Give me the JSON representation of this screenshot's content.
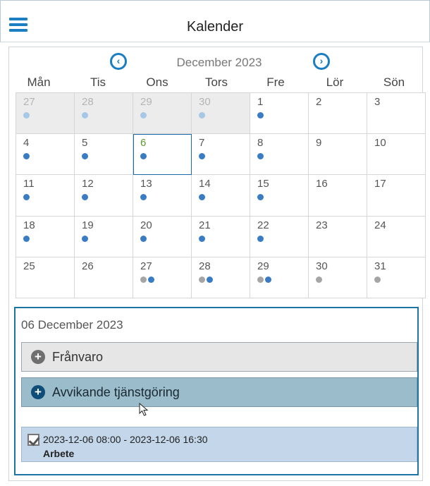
{
  "header": {
    "title": "Kalender"
  },
  "calendar": {
    "month_label": "December 2023",
    "weekdays": [
      "Mån",
      "Tis",
      "Ons",
      "Tors",
      "Fre",
      "Lör",
      "Sön"
    ],
    "cells": [
      {
        "day": "27",
        "other": true,
        "dots": [
          "faint"
        ]
      },
      {
        "day": "28",
        "other": true,
        "dots": [
          "faint"
        ]
      },
      {
        "day": "29",
        "other": true,
        "dots": [
          "faint"
        ]
      },
      {
        "day": "30",
        "other": true,
        "dots": [
          "faint"
        ]
      },
      {
        "day": "1",
        "other": false,
        "dots": [
          "blue"
        ]
      },
      {
        "day": "2",
        "other": false,
        "dots": []
      },
      {
        "day": "3",
        "other": false,
        "dots": []
      },
      {
        "day": "4",
        "other": false,
        "dots": [
          "blue"
        ]
      },
      {
        "day": "5",
        "other": false,
        "dots": [
          "blue"
        ]
      },
      {
        "day": "6",
        "other": false,
        "dots": [
          "blue"
        ],
        "today": true
      },
      {
        "day": "7",
        "other": false,
        "dots": [
          "blue"
        ]
      },
      {
        "day": "8",
        "other": false,
        "dots": [
          "blue"
        ]
      },
      {
        "day": "9",
        "other": false,
        "dots": []
      },
      {
        "day": "10",
        "other": false,
        "dots": []
      },
      {
        "day": "11",
        "other": false,
        "dots": [
          "blue"
        ]
      },
      {
        "day": "12",
        "other": false,
        "dots": [
          "blue"
        ]
      },
      {
        "day": "13",
        "other": false,
        "dots": [
          "blue"
        ]
      },
      {
        "day": "14",
        "other": false,
        "dots": [
          "blue"
        ]
      },
      {
        "day": "15",
        "other": false,
        "dots": [
          "blue"
        ]
      },
      {
        "day": "16",
        "other": false,
        "dots": []
      },
      {
        "day": "17",
        "other": false,
        "dots": []
      },
      {
        "day": "18",
        "other": false,
        "dots": [
          "blue"
        ]
      },
      {
        "day": "19",
        "other": false,
        "dots": [
          "blue"
        ]
      },
      {
        "day": "20",
        "other": false,
        "dots": [
          "blue"
        ]
      },
      {
        "day": "21",
        "other": false,
        "dots": [
          "blue"
        ]
      },
      {
        "day": "22",
        "other": false,
        "dots": [
          "blue"
        ]
      },
      {
        "day": "23",
        "other": false,
        "dots": []
      },
      {
        "day": "24",
        "other": false,
        "dots": []
      },
      {
        "day": "25",
        "other": false,
        "dots": []
      },
      {
        "day": "26",
        "other": false,
        "dots": []
      },
      {
        "day": "27",
        "other": false,
        "dots": [
          "grey",
          "blue"
        ]
      },
      {
        "day": "28",
        "other": false,
        "dots": [
          "grey",
          "blue"
        ]
      },
      {
        "day": "29",
        "other": false,
        "dots": [
          "grey",
          "blue"
        ]
      },
      {
        "day": "30",
        "other": false,
        "dots": [
          "grey"
        ]
      },
      {
        "day": "31",
        "other": false,
        "dots": [
          "grey"
        ]
      }
    ]
  },
  "day_panel": {
    "title": "06 December 2023",
    "absence_label": "Frånvaro",
    "deviation_label": "Avvikande tjänstgöring",
    "entry": {
      "time_range": "2023-12-06 08:00 - 2023-12-06 16:30",
      "type": "Arbete",
      "checked": true
    }
  },
  "icons": {
    "menu": "hamburger-menu-icon",
    "prev": "chevron-left-circle-icon",
    "next": "chevron-right-circle-icon",
    "add": "plus-circle-icon",
    "entry": "checkbox-checked-icon"
  },
  "colors": {
    "accent": "#1a7fc2",
    "event_dot": "#3a7cc4",
    "event_dot_faint": "#a7c7e6",
    "event_dot_grey": "#a5a5a5",
    "today_number": "#5a9a2a",
    "deviation_button": "#9bbcca",
    "entry_background": "#c3d6ea"
  }
}
